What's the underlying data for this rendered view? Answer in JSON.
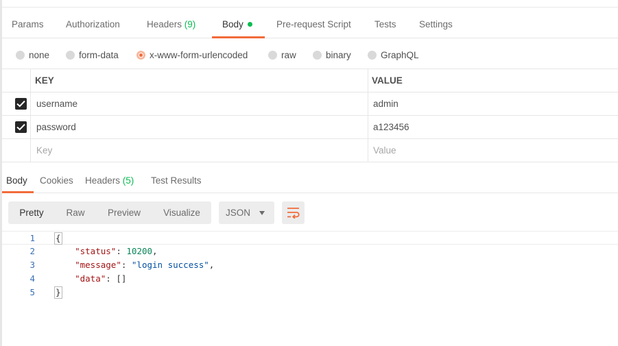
{
  "request_tabs": {
    "params": "Params",
    "authorization": "Authorization",
    "headers": "Headers",
    "headers_count": "(9)",
    "body": "Body",
    "pre_request_script": "Pre-request Script",
    "tests": "Tests",
    "settings": "Settings"
  },
  "body_types": {
    "none": "none",
    "form_data": "form-data",
    "x_www_form_urlencoded": "x-www-form-urlencoded",
    "raw": "raw",
    "binary": "binary",
    "graphql": "GraphQL",
    "selected": "x-www-form-urlencoded"
  },
  "params_table": {
    "key_header": "KEY",
    "value_header": "VALUE",
    "rows": [
      {
        "key": "username",
        "value": "admin",
        "checked": true
      },
      {
        "key": "password",
        "value": "a123456",
        "checked": true
      }
    ],
    "key_placeholder": "Key",
    "value_placeholder": "Value"
  },
  "response_tabs": {
    "body": "Body",
    "cookies": "Cookies",
    "headers": "Headers",
    "headers_count": "(5)",
    "test_results": "Test Results"
  },
  "response_view": {
    "pretty": "Pretty",
    "raw": "Raw",
    "preview": "Preview",
    "visualize": "Visualize",
    "format": "JSON"
  },
  "response_body": {
    "line_numbers": [
      "1",
      "2",
      "3",
      "4",
      "5"
    ],
    "open_brace": "{",
    "close_brace": "}",
    "status_key": "\"status\"",
    "status_value": "10200",
    "message_key": "\"message\"",
    "message_value": "\"login success\"",
    "data_key": "\"data\"",
    "data_value": "[]"
  },
  "colors": {
    "accent": "#f26b3a",
    "count_green": "#0cbb52",
    "line_number_blue": "#3b6fb6",
    "json_key": "#a31515",
    "json_string": "#0451a5",
    "json_number": "#098658"
  },
  "icons": {
    "wrap": "wrap-lines-icon",
    "dropdown": "chevron-down-icon",
    "checkbox": "checkmark-icon"
  }
}
